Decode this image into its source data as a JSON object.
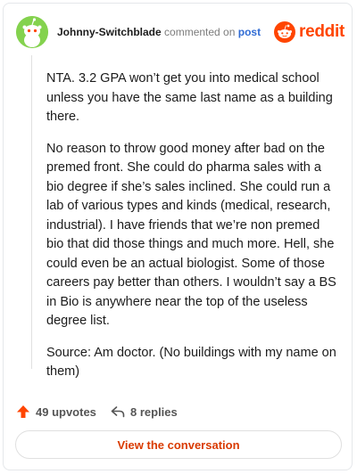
{
  "header": {
    "author": "Johnny-Switchblade",
    "commented_on": "commented on",
    "post_link": "post",
    "logo_text": "reddit"
  },
  "comment": {
    "paragraphs": [
      "NTA. 3.2 GPA won’t get you into medical school unless you have the same last name as a building there.",
      "No reason to throw good money after bad on the premed front. She could do pharma sales with a bio degree if she’s sales inclined. She could run a lab of various types and kinds (medical, research, industrial). I have friends that we’re non premed bio that did those things and much more. Hell, she could even be an actual biologist. Some of those careers pay better than others. I wouldn’t say a BS in Bio is anywhere near the top of the useless degree list.",
      "Source: Am doctor. (No buildings with my name on them)"
    ]
  },
  "footer": {
    "upvotes": "49 upvotes",
    "replies": "8 replies",
    "upvote_icon": "upvote-arrow-icon",
    "reply_icon": "reply-icon"
  },
  "cta": {
    "label": "View the conversation"
  },
  "colors": {
    "accent": "#ff4500",
    "link": "#2f6bd4",
    "avatar_bg": "#84d24e",
    "cta_text": "#d93a00"
  }
}
